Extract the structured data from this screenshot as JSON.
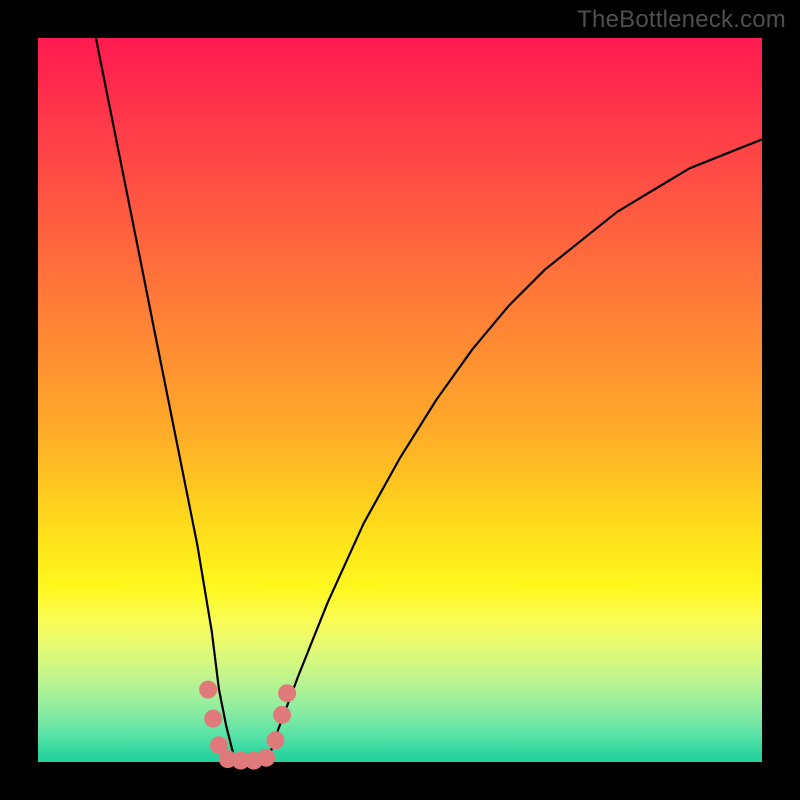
{
  "watermark": "TheBottleneck.com",
  "chart_data": {
    "type": "line",
    "title": "",
    "xlabel": "",
    "ylabel": "",
    "xlim": [
      0,
      100
    ],
    "ylim": [
      0,
      100
    ],
    "series": [
      {
        "name": "bottleneck-curve",
        "x": [
          8,
          10,
          12,
          14,
          16,
          18,
          20,
          22,
          24,
          25,
          26,
          27,
          28,
          29,
          30,
          31,
          32,
          33,
          36,
          40,
          45,
          50,
          55,
          60,
          65,
          70,
          75,
          80,
          85,
          90,
          95,
          100
        ],
        "values": [
          100,
          90,
          80,
          70,
          60,
          50,
          40,
          30,
          18,
          10,
          5,
          1,
          0,
          0,
          0,
          0,
          1,
          4,
          12,
          22,
          33,
          42,
          50,
          57,
          63,
          68,
          72,
          76,
          79,
          82,
          84,
          86
        ]
      }
    ],
    "markers": {
      "name": "highlight-dots",
      "color": "#e07a7a",
      "points": [
        {
          "x": 23.5,
          "y": 10
        },
        {
          "x": 24.2,
          "y": 6
        },
        {
          "x": 25.0,
          "y": 2.3
        },
        {
          "x": 26.2,
          "y": 0.4
        },
        {
          "x": 28.0,
          "y": 0.2
        },
        {
          "x": 29.8,
          "y": 0.2
        },
        {
          "x": 31.5,
          "y": 0.6
        },
        {
          "x": 32.8,
          "y": 3
        },
        {
          "x": 33.7,
          "y": 6.5
        },
        {
          "x": 34.4,
          "y": 9.5
        }
      ]
    },
    "colors": {
      "curve": "#000000",
      "marker": "#e07a7a",
      "gradient_top": "#ff1a4f",
      "gradient_mid": "#ffe51a",
      "gradient_bottom": "#21d19b",
      "frame": "#000000"
    }
  }
}
